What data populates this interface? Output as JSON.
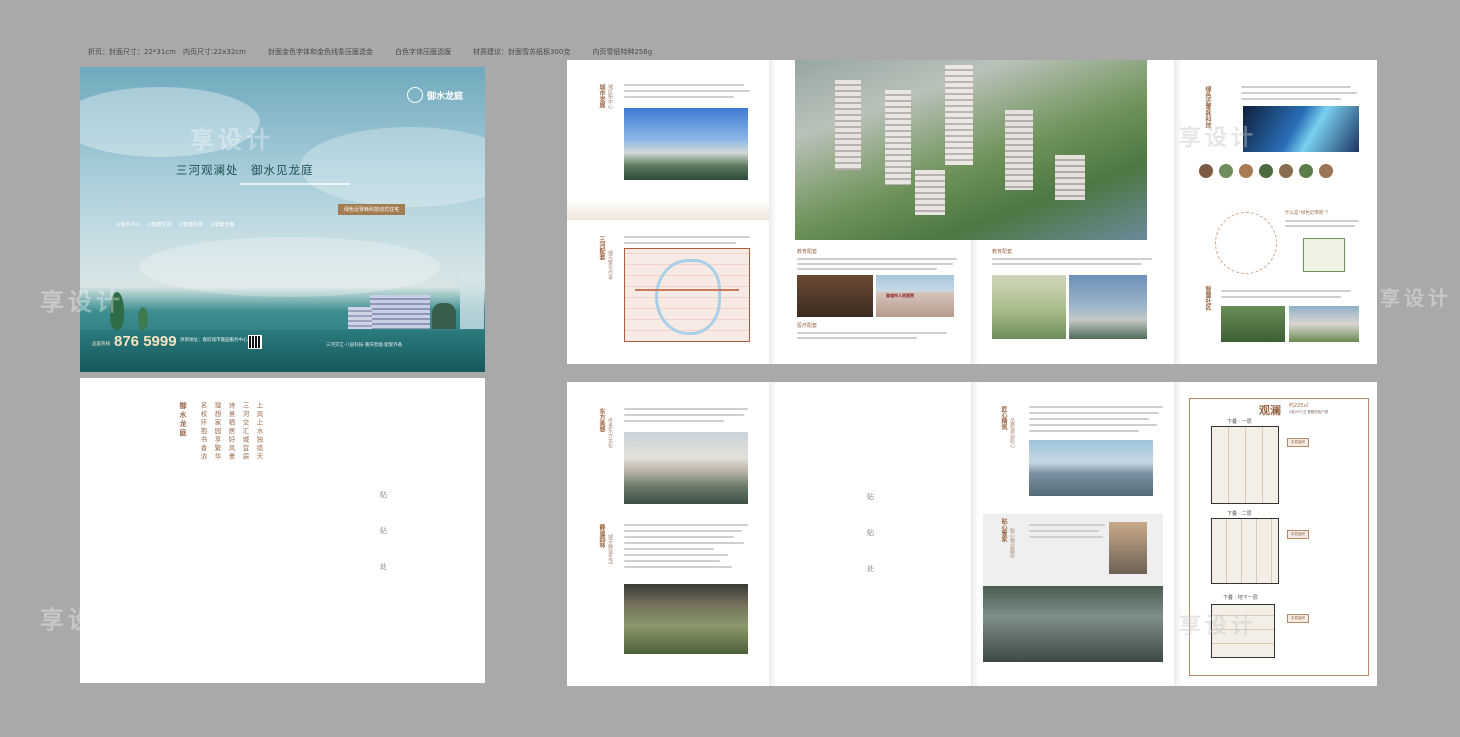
{
  "specs": [
    "折页：封面尺寸：22*31cm　内页尺寸:22x32cm",
    "封面金色字体和金色线条压膜烫金",
    "白色字体压膜烫膜",
    "材质建议：封面雪苏纸板300克",
    "内页雪纸特种256g"
  ],
  "cover": {
    "logo": "御水龙庭",
    "headline": "三河观澜处　御水见龙庭",
    "badge": "绿色近零耗科技动式住宅",
    "features": [
      "◎城市中心",
      "◎健康生活",
      "◎智能科技",
      "◎配套全备"
    ],
    "phone_prefix": "品鉴热线",
    "phone": "876 5999",
    "address": "项目地址：嘉欣城市嘉园服务中心",
    "tags": "三河交汇·八层科技·重庆智能·配套齐备"
  },
  "backpage": {
    "title": "御水龙庭",
    "poem": [
      "上风上水独揽天",
      "三河交汇城宜居",
      "诗意栖居好风景",
      "理想家园享繁华",
      "名校环抱书香浓"
    ],
    "paste": [
      "贴",
      "贴",
      "处"
    ]
  },
  "spread1": {
    "section1": "城市发展",
    "section1_sub": "城区新中心",
    "section2": "三河配套",
    "section2_sub": "城市繁华尽享",
    "edu_title": "教育配套",
    "med_title": "医疗配套",
    "school_title": "教育配套",
    "hospital_sign": "晋城市人民医院",
    "green_title": "绿色近零耗科技",
    "q1": "什么是“绿色近零耗”？",
    "green_sub": "智慧社区",
    "smart_title": "智慧社区"
  },
  "spread2": {
    "section1": "东方美感",
    "section1_sub": "传承东方文化",
    "section2": "静谧园林",
    "section2_sub": "城市静谧生活",
    "paste": [
      "贴",
      "贴",
      "处"
    ],
    "s3": "匠心精筑",
    "s3_sub": "品质源自匠心",
    "s4": "贴心管家",
    "s4_sub": "贴心物业服务",
    "plan_title": "观澜",
    "plan_area": "约225㎡",
    "plan_type": "4室2厅3卫 叠墅样板户型",
    "floor1": "下叠 · 一层",
    "floor2": "下叠 · 二层",
    "floor3": "下叠 · 地下一层",
    "plan_tag": "本层面积"
  },
  "watermark": "享设计",
  "colors": {
    "accent": "#9c6a48",
    "teal": "#1d6d6e",
    "sky": "#7fb6c7"
  }
}
